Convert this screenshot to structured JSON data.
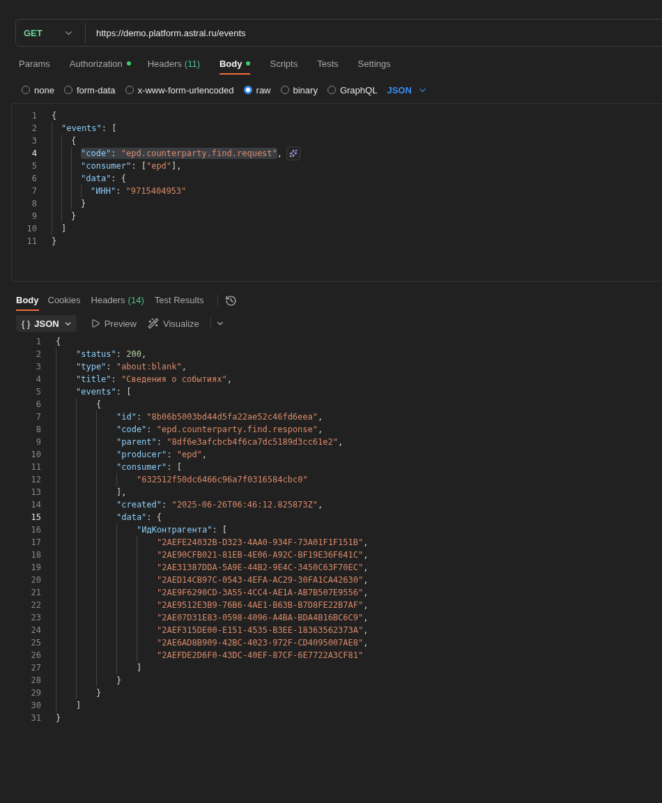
{
  "request": {
    "method": "GET",
    "url": "https://demo.platform.astral.ru/events"
  },
  "request_tabs": [
    {
      "label": "Params",
      "selected": false,
      "dot": false
    },
    {
      "label": "Authorization",
      "selected": false,
      "dot": true
    },
    {
      "label": "Headers",
      "count": "(11)",
      "selected": false,
      "dot": false
    },
    {
      "label": "Body",
      "selected": true,
      "dot": true
    },
    {
      "label": "Scripts",
      "selected": false,
      "dot": false
    },
    {
      "label": "Tests",
      "selected": false,
      "dot": false
    },
    {
      "label": "Settings",
      "selected": false,
      "dot": false
    }
  ],
  "body_types": [
    {
      "label": "none",
      "selected": false
    },
    {
      "label": "form-data",
      "selected": false
    },
    {
      "label": "x-www-form-urlencoded",
      "selected": false
    },
    {
      "label": "raw",
      "selected": true
    },
    {
      "label": "binary",
      "selected": false
    },
    {
      "label": "GraphQL",
      "selected": false
    }
  ],
  "raw_format": "JSON",
  "request_body": [
    {
      "number": "1",
      "active": false,
      "tokens": [
        {
          "kind": "punct",
          "text": "{"
        }
      ],
      "children": [
        {
          "number": "2",
          "active": false,
          "tokens": [
            {
              "kind": "key",
              "text": "\"events\""
            },
            {
              "kind": "punct",
              "text": ": ["
            }
          ],
          "children": [
            {
              "number": "3",
              "active": false,
              "tokens": [
                {
                  "kind": "punct",
                  "text": "{"
                }
              ],
              "children": [
                {
                  "number": "4",
                  "active": true,
                  "highlight": [
                    {
                      "kind": "key",
                      "text": "\"code\""
                    },
                    {
                      "kind": "punct",
                      "text": ": "
                    },
                    {
                      "kind": "string",
                      "text": "\"epd.counterparty.find.request\""
                    }
                  ],
                  "tokens": [
                    {
                      "kind": "punct",
                      "text": ","
                    }
                  ]
                },
                {
                  "number": "5",
                  "active": false,
                  "tokens": [
                    {
                      "kind": "key",
                      "text": "\"consumer\""
                    },
                    {
                      "kind": "punct",
                      "text": ": ["
                    },
                    {
                      "kind": "string",
                      "text": "\"epd\""
                    },
                    {
                      "kind": "punct",
                      "text": "],"
                    }
                  ]
                },
                {
                  "number": "6",
                  "active": false,
                  "tokens": [
                    {
                      "kind": "key",
                      "text": "\"data\""
                    },
                    {
                      "kind": "punct",
                      "text": ": {"
                    }
                  ],
                  "children": [
                    {
                      "number": "7",
                      "active": false,
                      "tokens": [
                        {
                          "kind": "key",
                          "text": "\"ИНН\""
                        },
                        {
                          "kind": "punct",
                          "text": ": "
                        },
                        {
                          "kind": "string",
                          "text": "\"9715404953\""
                        }
                      ]
                    }
                  ]
                },
                {
                  "number": "8",
                  "active": false,
                  "tokens": [
                    {
                      "kind": "punct",
                      "text": "}"
                    }
                  ]
                }
              ]
            },
            {
              "number": "9",
              "active": false,
              "tokens": [
                {
                  "kind": "punct",
                  "text": "}"
                }
              ]
            }
          ]
        },
        {
          "number": "10",
          "active": false,
          "tokens": [
            {
              "kind": "punct",
              "text": "]"
            }
          ]
        }
      ]
    },
    {
      "number": "11",
      "active": false,
      "tokens": [
        {
          "kind": "punct",
          "text": "}"
        }
      ]
    }
  ],
  "response_tabs": [
    {
      "label": "Body",
      "selected": true
    },
    {
      "label": "Cookies",
      "selected": false
    },
    {
      "label": "Headers",
      "count": "(14)",
      "selected": false
    },
    {
      "label": "Test Results",
      "selected": false
    }
  ],
  "response_toolbar": {
    "format_glyph": "{ }",
    "format": "JSON",
    "preview": "Preview",
    "visualize": "Visualize"
  },
  "response_body": [
    {
      "number": "1",
      "active": false,
      "tokens": [
        {
          "kind": "punct",
          "text": "{"
        }
      ],
      "children": [
        {
          "number": "2",
          "active": false,
          "tokens": [
            {
              "kind": "key",
              "text": "\"status\""
            },
            {
              "kind": "punct",
              "text": ": "
            },
            {
              "kind": "number",
              "text": "200"
            },
            {
              "kind": "punct",
              "text": ","
            }
          ]
        },
        {
          "number": "3",
          "active": false,
          "tokens": [
            {
              "kind": "key",
              "text": "\"type\""
            },
            {
              "kind": "punct",
              "text": ": "
            },
            {
              "kind": "string",
              "text": "\"about:blank\""
            },
            {
              "kind": "punct",
              "text": ","
            }
          ]
        },
        {
          "number": "4",
          "active": false,
          "tokens": [
            {
              "kind": "key",
              "text": "\"title\""
            },
            {
              "kind": "punct",
              "text": ": "
            },
            {
              "kind": "string",
              "text": "\"Сведения о событиях\""
            },
            {
              "kind": "punct",
              "text": ","
            }
          ]
        },
        {
          "number": "5",
          "active": false,
          "tokens": [
            {
              "kind": "key",
              "text": "\"events\""
            },
            {
              "kind": "punct",
              "text": ": ["
            }
          ],
          "children": [
            {
              "number": "6",
              "active": false,
              "tokens": [
                {
                  "kind": "punct",
                  "text": "{"
                }
              ],
              "children": [
                {
                  "number": "7",
                  "active": false,
                  "tokens": [
                    {
                      "kind": "key",
                      "text": "\"id\""
                    },
                    {
                      "kind": "punct",
                      "text": ": "
                    },
                    {
                      "kind": "string",
                      "text": "\"8b06b5003bd44d5fa22ae52c46fd6eea\""
                    },
                    {
                      "kind": "punct",
                      "text": ","
                    }
                  ]
                },
                {
                  "number": "8",
                  "active": false,
                  "tokens": [
                    {
                      "kind": "key",
                      "text": "\"code\""
                    },
                    {
                      "kind": "punct",
                      "text": ": "
                    },
                    {
                      "kind": "string",
                      "text": "\"epd.counterparty.find.response\""
                    },
                    {
                      "kind": "punct",
                      "text": ","
                    }
                  ]
                },
                {
                  "number": "9",
                  "active": false,
                  "tokens": [
                    {
                      "kind": "key",
                      "text": "\"parent\""
                    },
                    {
                      "kind": "punct",
                      "text": ": "
                    },
                    {
                      "kind": "string",
                      "text": "\"8df6e3afcbcb4f6ca7dc5189d3cc61e2\""
                    },
                    {
                      "kind": "punct",
                      "text": ","
                    }
                  ]
                },
                {
                  "number": "10",
                  "active": false,
                  "tokens": [
                    {
                      "kind": "key",
                      "text": "\"producer\""
                    },
                    {
                      "kind": "punct",
                      "text": ": "
                    },
                    {
                      "kind": "string",
                      "text": "\"epd\""
                    },
                    {
                      "kind": "punct",
                      "text": ","
                    }
                  ]
                },
                {
                  "number": "11",
                  "active": false,
                  "tokens": [
                    {
                      "kind": "key",
                      "text": "\"consumer\""
                    },
                    {
                      "kind": "punct",
                      "text": ": ["
                    }
                  ],
                  "children": [
                    {
                      "number": "12",
                      "active": false,
                      "tokens": [
                        {
                          "kind": "string",
                          "text": "\"632512f50dc6466c96a7f0316584cbc0\""
                        }
                      ]
                    }
                  ]
                },
                {
                  "number": "13",
                  "active": false,
                  "tokens": [
                    {
                      "kind": "punct",
                      "text": "],"
                    }
                  ]
                },
                {
                  "number": "14",
                  "active": false,
                  "tokens": [
                    {
                      "kind": "key",
                      "text": "\"created\""
                    },
                    {
                      "kind": "punct",
                      "text": ": "
                    },
                    {
                      "kind": "string",
                      "text": "\"2025-06-26T06:46:12.825873Z\""
                    },
                    {
                      "kind": "punct",
                      "text": ","
                    }
                  ]
                },
                {
                  "number": "15",
                  "active": true,
                  "tokens": [
                    {
                      "kind": "key",
                      "text": "\"data\""
                    },
                    {
                      "kind": "punct",
                      "text": ": {"
                    }
                  ],
                  "children": [
                    {
                      "number": "16",
                      "active": false,
                      "tokens": [
                        {
                          "kind": "key",
                          "text": "\"ИдКонтрагента\""
                        },
                        {
                          "kind": "punct",
                          "text": ": ["
                        }
                      ],
                      "children": [
                        {
                          "number": "17",
                          "active": false,
                          "tokens": [
                            {
                              "kind": "string",
                              "text": "\"2AEFE24032B-D323-4AA0-934F-73A01F1F151B\""
                            },
                            {
                              "kind": "punct",
                              "text": ","
                            }
                          ]
                        },
                        {
                          "number": "18",
                          "active": false,
                          "tokens": [
                            {
                              "kind": "string",
                              "text": "\"2AE90CFB021-81EB-4E06-A92C-BF19E36F641C\""
                            },
                            {
                              "kind": "punct",
                              "text": ","
                            }
                          ]
                        },
                        {
                          "number": "19",
                          "active": false,
                          "tokens": [
                            {
                              "kind": "string",
                              "text": "\"2AE31387DDA-5A9E-44B2-9E4C-3450C63F70EC\""
                            },
                            {
                              "kind": "punct",
                              "text": ","
                            }
                          ]
                        },
                        {
                          "number": "20",
                          "active": false,
                          "tokens": [
                            {
                              "kind": "string",
                              "text": "\"2AED14CB97C-0543-4EFA-AC29-30FA1CA42630\""
                            },
                            {
                              "kind": "punct",
                              "text": ","
                            }
                          ]
                        },
                        {
                          "number": "21",
                          "active": false,
                          "tokens": [
                            {
                              "kind": "string",
                              "text": "\"2AE9F6290CD-3A55-4CC4-AE1A-AB7B507E9556\""
                            },
                            {
                              "kind": "punct",
                              "text": ","
                            }
                          ]
                        },
                        {
                          "number": "22",
                          "active": false,
                          "tokens": [
                            {
                              "kind": "string",
                              "text": "\"2AE9512E3B9-76B6-4AE1-B63B-B7D8FE22B7AF\""
                            },
                            {
                              "kind": "punct",
                              "text": ","
                            }
                          ]
                        },
                        {
                          "number": "23",
                          "active": false,
                          "tokens": [
                            {
                              "kind": "string",
                              "text": "\"2AE07D31E83-0598-4096-A4BA-BDA4B16BC6C9\""
                            },
                            {
                              "kind": "punct",
                              "text": ","
                            }
                          ]
                        },
                        {
                          "number": "24",
                          "active": false,
                          "tokens": [
                            {
                              "kind": "string",
                              "text": "\"2AEF315DE00-E151-4535-B3EE-18363562373A\""
                            },
                            {
                              "kind": "punct",
                              "text": ","
                            }
                          ]
                        },
                        {
                          "number": "25",
                          "active": false,
                          "tokens": [
                            {
                              "kind": "string",
                              "text": "\"2AE6AD8B909-42BC-4023-972F-CD4095007AE8\""
                            },
                            {
                              "kind": "punct",
                              "text": ","
                            }
                          ]
                        },
                        {
                          "number": "26",
                          "active": false,
                          "tokens": [
                            {
                              "kind": "string",
                              "text": "\"2AEFDE2D6F0-43DC-40EF-87CF-6E7722A3CF81\""
                            }
                          ]
                        }
                      ]
                    },
                    {
                      "number": "27",
                      "active": false,
                      "tokens": [
                        {
                          "kind": "punct",
                          "text": "]"
                        }
                      ]
                    }
                  ]
                },
                {
                  "number": "28",
                  "active": false,
                  "tokens": [
                    {
                      "kind": "punct",
                      "text": "}"
                    }
                  ]
                }
              ]
            },
            {
              "number": "29",
              "active": false,
              "tokens": [
                {
                  "kind": "punct",
                  "text": "}"
                }
              ]
            }
          ]
        },
        {
          "number": "30",
          "active": false,
          "tokens": [
            {
              "kind": "punct",
              "text": "]"
            }
          ]
        }
      ]
    },
    {
      "number": "31",
      "active": false,
      "tokens": [
        {
          "kind": "punct",
          "text": "}"
        }
      ]
    }
  ]
}
